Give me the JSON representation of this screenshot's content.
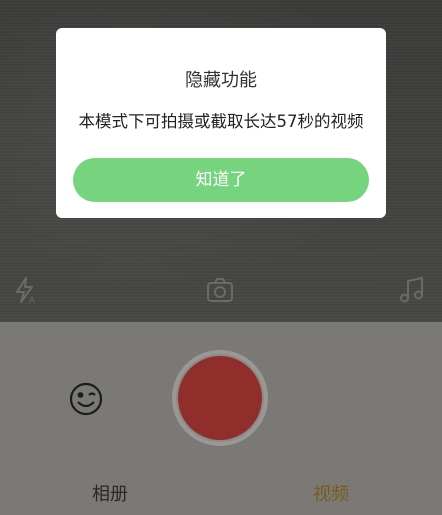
{
  "dialog": {
    "title": "隐藏功能",
    "message": "本模式下可拍摄或截取长达57秒的视频",
    "confirm_label": "知道了"
  },
  "camera": {
    "controls": {
      "flash_icon": "flash-auto-icon",
      "switch_icon": "switch-camera-icon",
      "music_icon": "music-note-icon"
    }
  },
  "bottom_bar": {
    "emoji_icon": "emoji-face-icon",
    "record_icon": "record-button",
    "tabs": [
      {
        "label": "相册",
        "selected": false
      },
      {
        "label": "视频",
        "selected": true
      }
    ]
  },
  "colors": {
    "confirm_button": "#76d47f",
    "record_button": "#8f2e2b",
    "selected_tab": "#7a5a1a"
  }
}
